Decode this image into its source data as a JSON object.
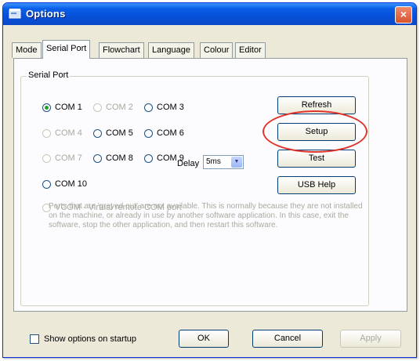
{
  "window": {
    "title": "Options",
    "close_glyph": "×"
  },
  "tabs": [
    "Mode",
    "Serial Port",
    "Flowchart",
    "Language",
    "Colour",
    "Editor"
  ],
  "active_tab": "Serial Port",
  "group_label": "Serial Port",
  "ports": [
    {
      "label": "COM 1",
      "state": "checked"
    },
    {
      "label": "COM 2",
      "state": "disabled"
    },
    {
      "label": "COM 3",
      "state": "enabled"
    },
    {
      "label": "COM 4",
      "state": "disabled"
    },
    {
      "label": "COM 5",
      "state": "enabled"
    },
    {
      "label": "COM 6",
      "state": "enabled"
    },
    {
      "label": "COM 7",
      "state": "disabled"
    },
    {
      "label": "COM 8",
      "state": "enabled"
    },
    {
      "label": "COM 9",
      "state": "enabled"
    },
    {
      "label": "COM 10",
      "state": "enabled"
    }
  ],
  "vcom_label": "VCOM - Virtual remote COM port",
  "delay": {
    "label": "Delay",
    "value": "5ms"
  },
  "buttons": {
    "refresh": "Refresh",
    "setup": "Setup",
    "test": "Test",
    "usb_help": "USB Help",
    "ok": "OK",
    "cancel": "Cancel",
    "apply": "Apply"
  },
  "note": "Ports that are 'greyed out' are not available. This is normally because they are not installed on the machine, or already in use by another software application. In this case, exit the software, stop the other application, and then restart this software.",
  "startup_checkbox": "Show options on startup",
  "highlight_color": "#e2332b"
}
